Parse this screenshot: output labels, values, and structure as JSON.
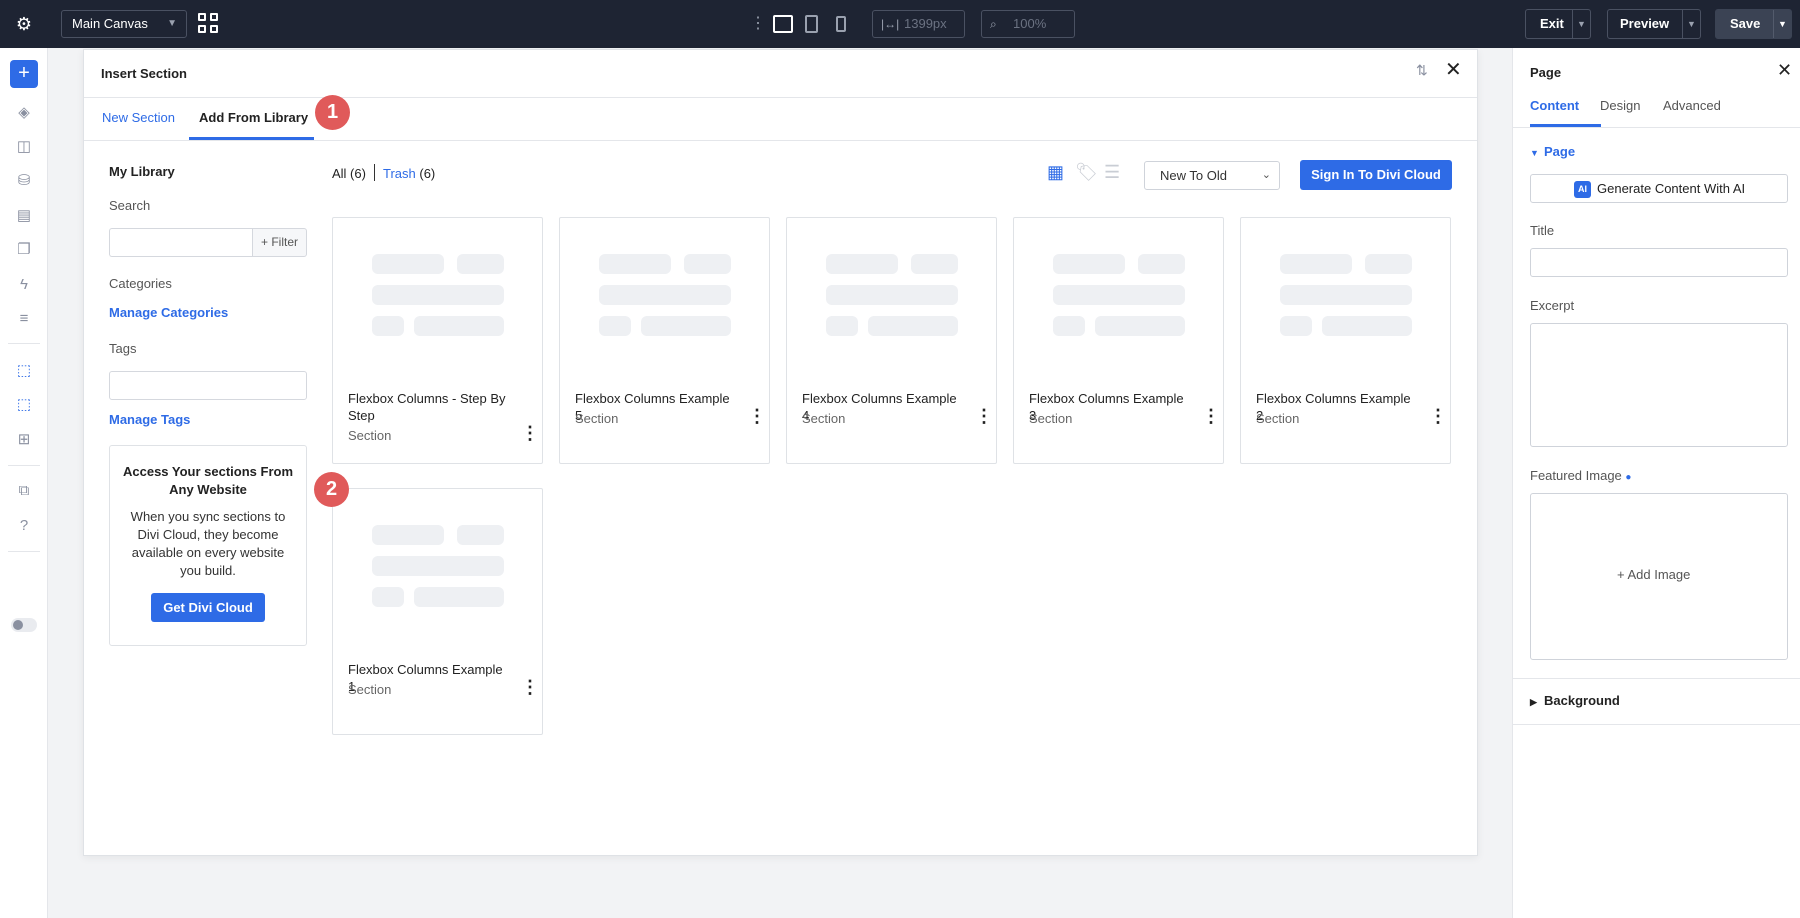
{
  "topbar": {
    "canvas_select": "Main Canvas",
    "width_value": "1399px",
    "zoom_value": "100%",
    "exit_label": "Exit",
    "preview_label": "Preview",
    "save_label": "Save"
  },
  "insert_section": {
    "title": "Insert Section",
    "tabs": [
      {
        "label": "New Section"
      },
      {
        "label": "Add From Library"
      }
    ],
    "badges": [
      "1",
      "2"
    ]
  },
  "library": {
    "heading": "My Library",
    "search_label": "Search",
    "filter_label": "+ Filter",
    "categories_label": "Categories",
    "manage_categories": "Manage Categories",
    "tags_label": "Tags",
    "manage_tags": "Manage Tags",
    "promo": {
      "title": "Access Your sections From Any Website",
      "text": "When you sync sections to Divi Cloud, they become available on every website you build.",
      "button": "Get Divi Cloud"
    },
    "filter_all": "All (6)",
    "filter_trash_name": "Trash",
    "filter_trash_count": "(6)",
    "sort_select": "New To Old",
    "sign_in_button": "Sign In To Divi Cloud",
    "items": [
      {
        "title": "Flexbox Columns - Step By Step",
        "type": "Section"
      },
      {
        "title": "Flexbox Columns Example 5",
        "type": "Section"
      },
      {
        "title": "Flexbox Columns Example 4",
        "type": "Section"
      },
      {
        "title": "Flexbox Columns Example 3",
        "type": "Section"
      },
      {
        "title": "Flexbox Columns Example 2",
        "type": "Section"
      },
      {
        "title": "Flexbox Columns Example 1",
        "type": "Section"
      }
    ]
  },
  "settings": {
    "title": "Page",
    "tabs": [
      {
        "label": "Content"
      },
      {
        "label": "Design"
      },
      {
        "label": "Advanced"
      }
    ],
    "section_page": "Page",
    "ai_button": "Generate Content With AI",
    "ai_icon_text": "AI",
    "title_label": "Title",
    "excerpt_label": "Excerpt",
    "featured_image_label": "Featured Image",
    "add_image": "Add Image",
    "section_background": "Background"
  },
  "colors": {
    "accent": "#2e6be6",
    "topbar": "#1e2433",
    "badge": "#e05a5a"
  }
}
